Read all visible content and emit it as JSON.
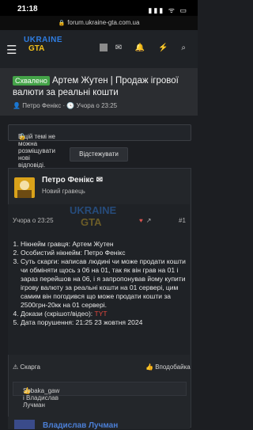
{
  "status_bar": {
    "time": "21:18",
    "icons": "▮▮▮ ᯤ ▭"
  },
  "browser": {
    "lock_icon": "lock-icon",
    "url": "forum.ukraine-gta.com.ua"
  },
  "topnav": {
    "logo_line1": "UKRAINE",
    "logo_line2": "GTA",
    "icons": [
      "menu-icon",
      "avatar",
      "mail-icon",
      "bell-icon",
      "bolt-icon",
      "search-icon"
    ],
    "icon_glyphs": {
      "menu": "☰",
      "mail": "✉",
      "bell": "🔔",
      "bolt": "⚡",
      "search": "⌕"
    }
  },
  "thread": {
    "prefix": "Схвалено",
    "title": "Артем Жутен | Продаж ігрової валюти за реальні кошти",
    "author": "Петро Фенікс",
    "date": "Учора о 23:25",
    "author_icon": "user-icon",
    "date_icon": "clock-icon"
  },
  "notice": {
    "icon": "lock-icon",
    "text": "В цій темі не можна розміщувати нові відповіді."
  },
  "watch_button": {
    "label": "Відстежувати"
  },
  "post": {
    "username": "Петро Фенікс",
    "username_suffix": "✉",
    "user_title": "Новий гравець",
    "date": "Учора о 23:25",
    "number": "#1",
    "watermark_line1": "UKRAINE",
    "watermark_line2": "GTA",
    "items": [
      {
        "text": "Нікнейм гравця: Артем Жутен"
      },
      {
        "text": "Особистий нікнейм: Петро Фенікс"
      },
      {
        "text": "Суть скарги: написав людині чи може продати кошти чи обміняти щось з 06 на 01, так як він грав на 01 і зараз перейшов на 06, і я запропонував йому купити ігрову валюту за реальні кошти на 01 сервері, цим самим він погодився що може продати кошти за 2500грн-20кк на 01 сервері."
      },
      {
        "text": "Докази (скрішот/відео): ",
        "highlight": "TYT"
      },
      {
        "text": "Дата порушення: 21:25 23 жовтня 2024"
      }
    ],
    "report_label": "Скарга",
    "share_label": "Вподобайка",
    "reactions_text": "Sobaka_gaw і Владислав Лучман"
  },
  "next_post": {
    "username": "Владислав Лучман"
  },
  "colors": {
    "approved": "#44a348",
    "link": "#4b7fd6",
    "accent_red": "#e0473e"
  }
}
